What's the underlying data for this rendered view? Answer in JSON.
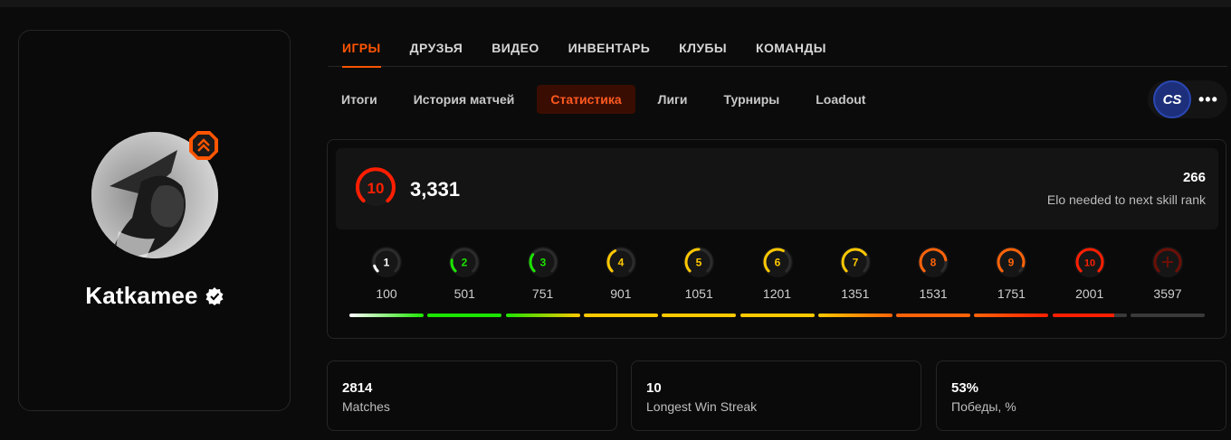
{
  "main_tabs": [
    {
      "label": "ИГРЫ"
    },
    {
      "label": "ДРУЗЬЯ"
    },
    {
      "label": "ВИДЕО"
    },
    {
      "label": "ИНВЕНТАРЬ"
    },
    {
      "label": "КЛУБЫ"
    },
    {
      "label": "КОМАНДЫ"
    }
  ],
  "sub_tabs": [
    {
      "label": "Итоги"
    },
    {
      "label": "История матчей"
    },
    {
      "label": "Статистика"
    },
    {
      "label": "Лиги"
    },
    {
      "label": "Турниры"
    },
    {
      "label": "Loadout"
    }
  ],
  "profile": {
    "username": "Katkamee",
    "verified": true
  },
  "game": {
    "logo_text": "CS",
    "more_label": "•••"
  },
  "elo": {
    "level": "10",
    "value": "3,331",
    "needed": "266",
    "needed_label": "Elo needed to next skill rank"
  },
  "skill_levels": [
    {
      "label": "1",
      "threshold": "100",
      "color": "#ffffff",
      "fill": 0.1
    },
    {
      "label": "2",
      "threshold": "501",
      "color": "#1ce400",
      "fill": 0.2
    },
    {
      "label": "3",
      "threshold": "751",
      "color": "#1ce400",
      "fill": 0.3
    },
    {
      "label": "4",
      "threshold": "901",
      "color": "#ffc800",
      "fill": 0.4
    },
    {
      "label": "5",
      "threshold": "1051",
      "color": "#ffc800",
      "fill": 0.5
    },
    {
      "label": "6",
      "threshold": "1201",
      "color": "#ffc800",
      "fill": 0.6
    },
    {
      "label": "7",
      "threshold": "1351",
      "color": "#ffc800",
      "fill": 0.7
    },
    {
      "label": "8",
      "threshold": "1531",
      "color": "#ff6309",
      "fill": 0.8
    },
    {
      "label": "9",
      "threshold": "1751",
      "color": "#ff6309",
      "fill": 0.9
    },
    {
      "label": "10",
      "threshold": "2001",
      "color": "#fe1f00",
      "fill": 1.0
    },
    {
      "label": "",
      "threshold": "3597",
      "color": "#6b0f06",
      "fill": 1.0
    }
  ],
  "progress_bars": [
    {
      "from": "#ffffff",
      "to": "#1ce400",
      "fill": 1
    },
    {
      "from": "#1ce400",
      "to": "#1ce400",
      "fill": 1
    },
    {
      "from": "#1ce400",
      "to": "#ffc800",
      "fill": 1
    },
    {
      "from": "#ffc800",
      "to": "#ffc800",
      "fill": 1
    },
    {
      "from": "#ffc800",
      "to": "#ffc800",
      "fill": 1
    },
    {
      "from": "#ffc800",
      "to": "#ffc800",
      "fill": 1
    },
    {
      "from": "#ffc800",
      "to": "#ff6309",
      "fill": 1
    },
    {
      "from": "#ff6309",
      "to": "#ff6309",
      "fill": 1
    },
    {
      "from": "#ff6309",
      "to": "#fe1f00",
      "fill": 1
    },
    {
      "from": "#fe1f00",
      "to": "#fe1f00",
      "fill": 0.83
    },
    {
      "from": "#3a3a3a",
      "to": "#3a3a3a",
      "fill": 1
    }
  ],
  "stats": [
    {
      "value": "2814",
      "label": "Matches"
    },
    {
      "value": "10",
      "label": "Longest Win Streak"
    },
    {
      "value": "53%",
      "label": "Победы, %"
    }
  ],
  "colors": {
    "accent": "#ff5500",
    "active_tab_bg": "#3a0d03",
    "level10": "#fe1f00"
  }
}
